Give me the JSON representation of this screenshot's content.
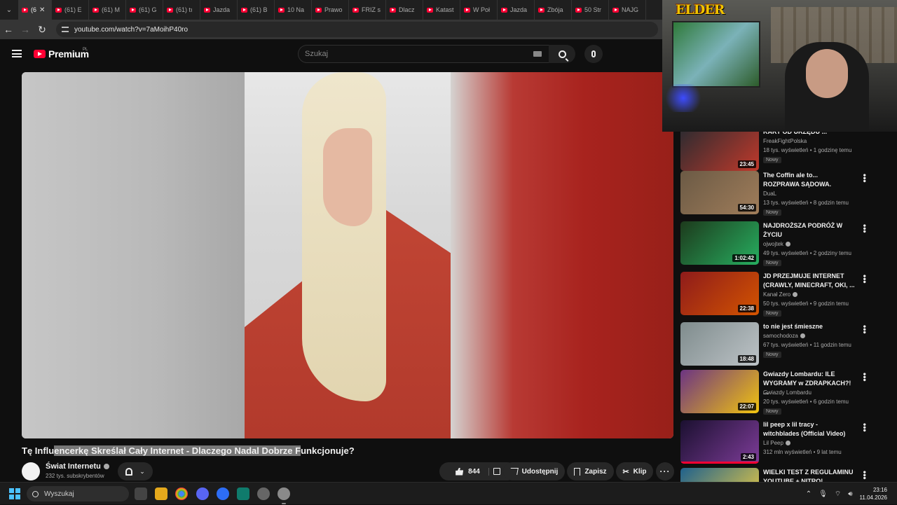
{
  "browser": {
    "tabs": [
      {
        "label": "(6",
        "active": true
      },
      {
        "label": "(61) E"
      },
      {
        "label": "(61) M"
      },
      {
        "label": "(61) G"
      },
      {
        "label": "(61) tı"
      },
      {
        "label": "Jazda"
      },
      {
        "label": "(61) B"
      },
      {
        "label": "10 Na"
      },
      {
        "label": "Prawo"
      },
      {
        "label": "FRIZ s"
      },
      {
        "label": "Dlacz"
      },
      {
        "label": "Katast"
      },
      {
        "label": "W Poł"
      },
      {
        "label": "Jazda"
      },
      {
        "label": "Zbója"
      },
      {
        "label": "50 Str"
      },
      {
        "label": "NAJG"
      }
    ],
    "close_glyph": "✕",
    "url": "youtube.com/watch?v=7aMoihP40ro"
  },
  "youtube": {
    "logo_text": "Premium",
    "region": "PL",
    "search_placeholder": "Szukaj"
  },
  "video": {
    "title_prefix": "Tę Influ",
    "title_highlight": "encerkę Skreślał Cały Internet - Dlaczego Nadal Dobrze F",
    "title_suffix": "unkcjonuje?",
    "channel_name": "Świat Internetu",
    "subscribers": "232 tys. subskrybentów",
    "likes": "844",
    "share_label": "Udostępnij",
    "save_label": "Zapisz",
    "clip_label": "Klip"
  },
  "webcam": {
    "logo_text": "ELDER"
  },
  "recommendations": [
    {
      "title": "KARY OD URZĘDU ...",
      "channel": "FreakFightPolska",
      "verified": false,
      "meta": "18 tys. wyświetleń • 1 godzinę temu",
      "badge": "Nowy",
      "duration": "23:45",
      "thumb_colors": [
        "#2b2b30",
        "#c0392b"
      ]
    },
    {
      "title": "The Coffin ale to... ROZPRAWA SĄDOWA.",
      "channel": "DuaL",
      "verified": false,
      "meta": "13 tys. wyświetleń • 8 godzin temu",
      "badge": "Nowy",
      "duration": "54:30",
      "thumb_colors": [
        "#6b5a45",
        "#a07d5a"
      ]
    },
    {
      "title": "NAJDROŻSZA PODRÓŻ W ŻYCIU",
      "channel": "ojwojtek",
      "verified": true,
      "meta": "49 tys. wyświetleń • 2 godziny temu",
      "badge": "Nowy",
      "duration": "1:02:42",
      "thumb_colors": [
        "#1d3a1c",
        "#27ae60"
      ]
    },
    {
      "title": "JD PRZEJMUJE INTERNET (CRAWLY, MINECRAFT, OKI, ...",
      "channel": "Kanał Zero",
      "verified": true,
      "meta": "50 tys. wyświetleń • 9 godzin temu",
      "badge": "Nowy",
      "duration": "22:38",
      "thumb_colors": [
        "#8e1b1b",
        "#d35400"
      ]
    },
    {
      "title": "to nie jest śmieszne",
      "channel": "samochodoza",
      "verified": true,
      "meta": "67 tys. wyświetleń • 11 godzin temu",
      "badge": "Nowy",
      "duration": "18:48",
      "thumb_colors": [
        "#7f8c8d",
        "#bdc3c7"
      ]
    },
    {
      "title": "Gwiazdy Lombardu: ILE WYGRAMY w ZDRAPKACH?! ...",
      "channel": "Gwiazdy Lombardu",
      "verified": false,
      "meta": "20 tys. wyświetleń • 6 godzin temu",
      "badge": "Nowy",
      "duration": "22:07",
      "thumb_colors": [
        "#6c3483",
        "#f1c40f"
      ]
    },
    {
      "title": "lil peep x lil tracy - witchblades (Official Video)",
      "channel": "Lil Peep",
      "verified": true,
      "meta": "312 mln wyświetleń • 9 lat temu",
      "badge": "",
      "duration": "2:43",
      "thumb_colors": [
        "#1b1030",
        "#7d3c98"
      ]
    },
    {
      "title": "WIELKI TEST Z REGULAMINU YOUTUBE + NITRO!",
      "channel": "",
      "verified": false,
      "meta": "",
      "badge": "",
      "duration": "",
      "thumb_colors": [
        "#1f618d",
        "#f4d03f"
      ]
    }
  ],
  "taskbar": {
    "search_label": "Wyszukaj",
    "time": "23:16",
    "date": "11.04.2026"
  }
}
